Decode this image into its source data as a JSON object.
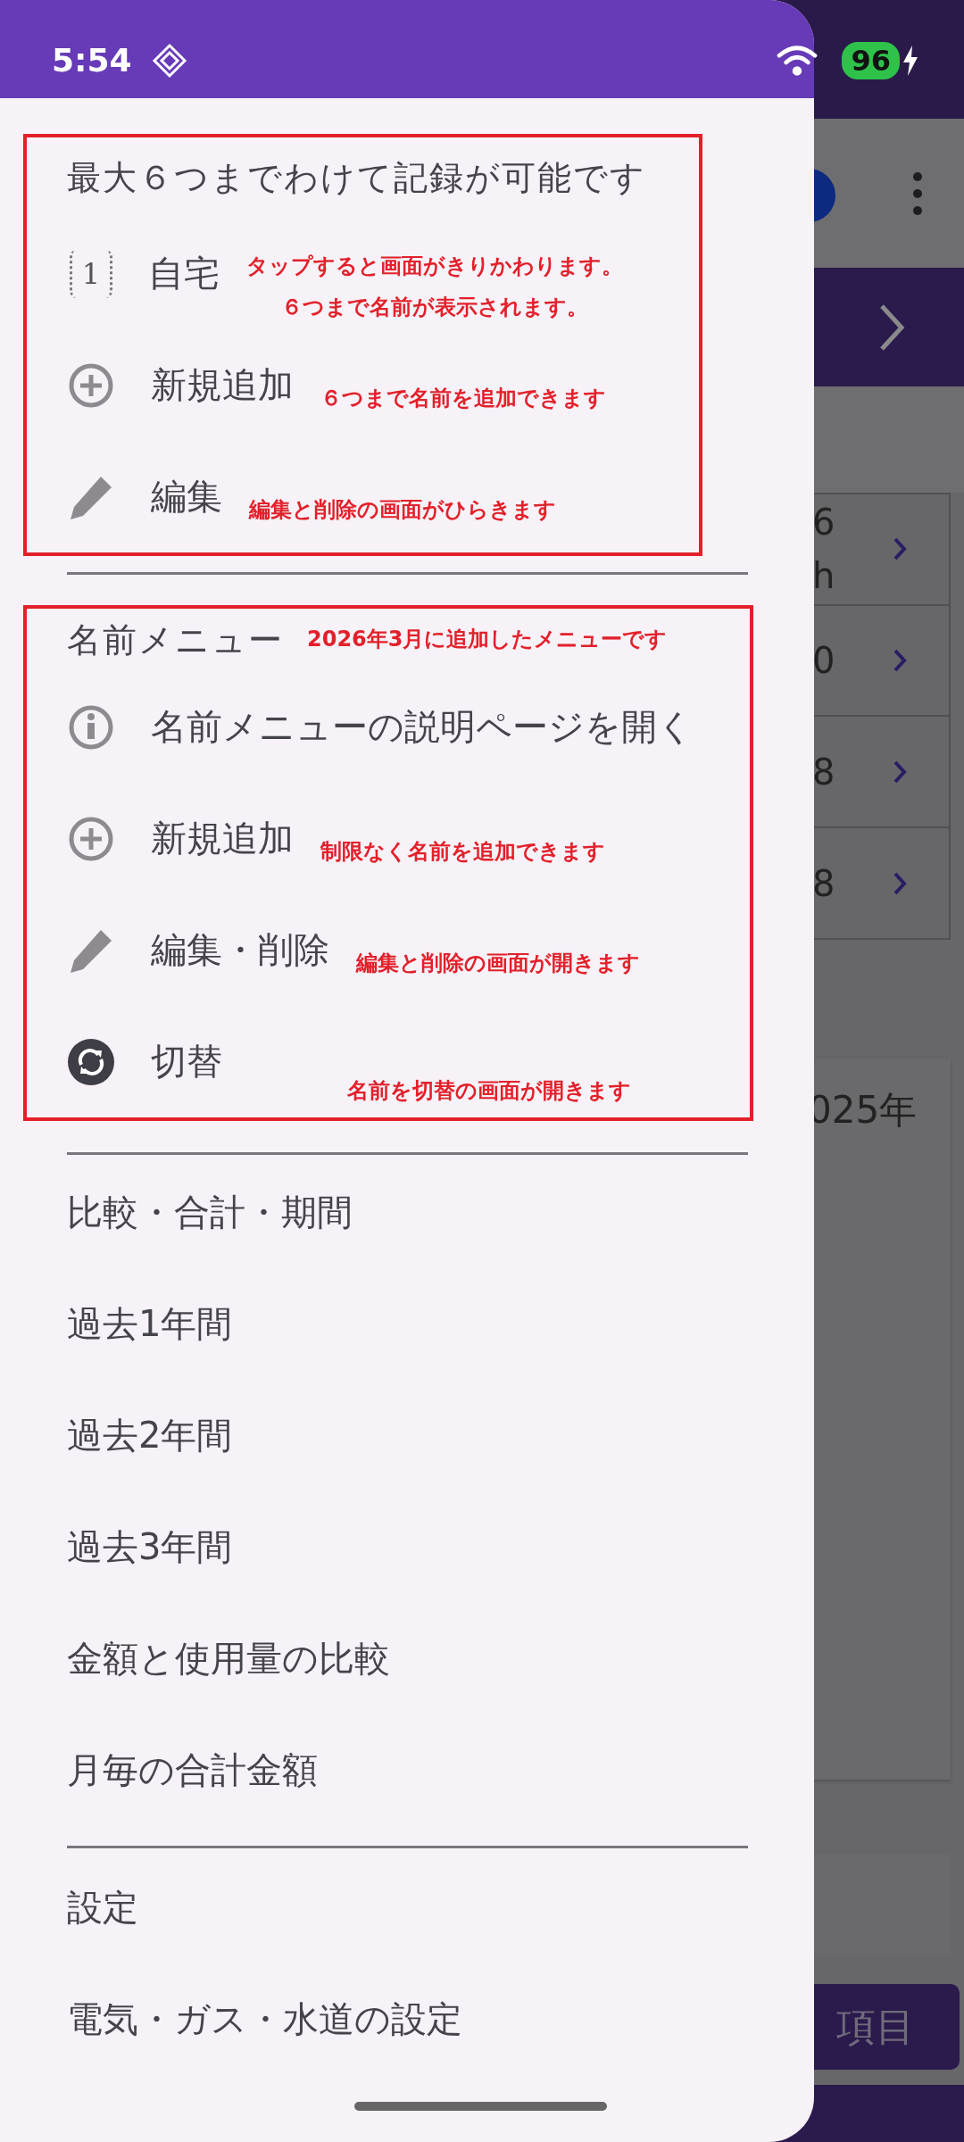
{
  "status_bar": {
    "time": "5:54",
    "battery": "96",
    "charging": true
  },
  "drawer": {
    "sections": [
      {
        "highlighted": true,
        "heading": "最大６つまでわけて記録が可能です",
        "items": [
          {
            "kind": "number",
            "badge": "1",
            "label": "自宅",
            "notes": [
              "タップすると画面がきりかわります。",
              "６つまで名前が表示されます。"
            ]
          },
          {
            "kind": "plus",
            "label": "新規追加",
            "notes": [
              "６つまで名前を追加できます"
            ]
          },
          {
            "kind": "pencil",
            "label": "編集",
            "notes": [
              "編集と削除の画面がひらきます"
            ]
          }
        ]
      },
      {
        "highlighted": true,
        "heading": "名前メニュー",
        "heading_note": "2026年3月に追加したメニューです",
        "items": [
          {
            "kind": "info",
            "label": "名前メニューの説明ページを開く"
          },
          {
            "kind": "plus",
            "label": "新規追加",
            "notes": [
              "制限なく名前を追加できます"
            ]
          },
          {
            "kind": "pencil",
            "label": "編集・削除",
            "notes": [
              "編集と削除の画面が開きます"
            ]
          },
          {
            "kind": "sync",
            "label": "切替",
            "notes": [
              "名前を切替の画面が開きます"
            ]
          }
        ]
      },
      {
        "items": [
          {
            "label": "比較・合計・期間"
          },
          {
            "label": "過去1年間"
          },
          {
            "label": "過去2年間"
          },
          {
            "label": "過去3年間"
          },
          {
            "label": "金額と使用量の比較"
          },
          {
            "label": "月毎の合計金額"
          }
        ]
      },
      {
        "items": [
          {
            "label": "設定"
          },
          {
            "label": "電気・ガス・水道の設定"
          }
        ]
      }
    ]
  },
  "background": {
    "rows": [
      {
        "value": "6",
        "unit": "h"
      },
      {
        "value": "0"
      },
      {
        "value": "8"
      },
      {
        "value": "8"
      }
    ],
    "card_text": "025年",
    "button": "項目"
  }
}
